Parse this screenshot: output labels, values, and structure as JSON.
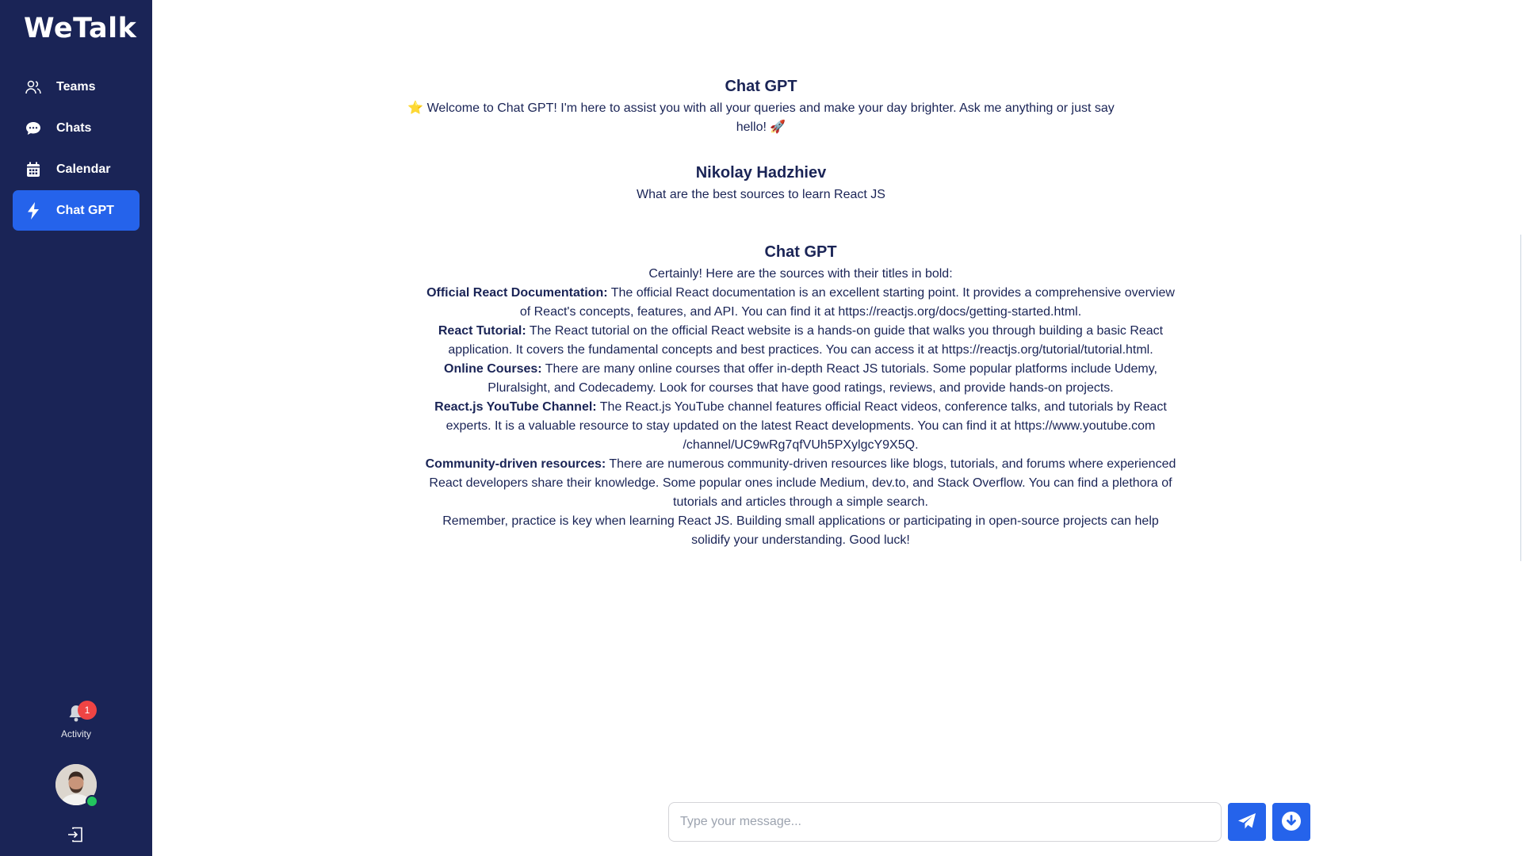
{
  "app": {
    "name": "WeTalk"
  },
  "sidebar": {
    "items": [
      {
        "label": "Teams",
        "icon": "users-icon"
      },
      {
        "label": "Chats",
        "icon": "chat-bubble-icon"
      },
      {
        "label": "Calendar",
        "icon": "calendar-icon"
      },
      {
        "label": "Chat GPT",
        "icon": "bolt-icon",
        "active": true
      }
    ],
    "activity": {
      "label": "Activity",
      "badge_count": "1",
      "icon": "bell-icon"
    },
    "avatar": {
      "status": "online",
      "status_color": "#22c55e"
    },
    "logout_icon": "logout-icon"
  },
  "messages": [
    {
      "sender": "Chat GPT",
      "text": "⭐ Welcome to Chat GPT! I'm here to assist you with all your queries and make your day brighter. Ask me anything or just say hello! 🚀"
    },
    {
      "sender": "Nikolay Hadzhiev",
      "text": "What are the best sources to learn React JS"
    },
    {
      "sender": "Chat GPT",
      "intro": "Certainly! Here are the sources with their titles in bold:",
      "sources": [
        {
          "title": "Official React Documentation:",
          "lines": [
            "The official React documentation is an excellent starting point. It provides a comprehensive overview",
            "of React's concepts, features, and API. You can find it at https://reactjs.org/docs/getting-started.html."
          ]
        },
        {
          "title": "React Tutorial:",
          "lines": [
            "The React tutorial on the official React website is a hands-on guide that walks you through building a basic React",
            "application. It covers the fundamental concepts and best practices. You can access it at https://reactjs.org/tutorial/tutorial.html."
          ]
        },
        {
          "title": "Online Courses:",
          "lines": [
            "There are many online courses that offer in-depth React JS tutorials. Some popular platforms include Udemy,",
            "Pluralsight, and Codecademy. Look for courses that have good ratings, reviews, and provide hands-on projects."
          ]
        },
        {
          "title": "React.js YouTube Channel:",
          "lines": [
            "The React.js YouTube channel features official React videos, conference talks, and tutorials by React",
            "experts. It is a valuable resource to stay updated on the latest React developments. You can find it at https://www.youtube.com",
            "/channel/UC9wRg7qfVUh5PXylgcY9X5Q."
          ]
        },
        {
          "title": "Community-driven resources:",
          "lines": [
            "There are numerous community-driven resources like blogs, tutorials, and forums where experienced",
            "React developers share their knowledge. Some popular ones include Medium, dev.to, and Stack Overflow. You can find a plethora of",
            "tutorials and articles through a simple search."
          ]
        }
      ],
      "closing": [
        "Remember, practice is key when learning React JS. Building small applications or participating in open-source projects can help",
        "solidify your understanding. Good luck!"
      ]
    }
  ],
  "composer": {
    "placeholder": "Type your message...",
    "value": "",
    "send_icon": "send-icon",
    "download_icon": "download-icon",
    "accent_color": "#2563eb"
  }
}
